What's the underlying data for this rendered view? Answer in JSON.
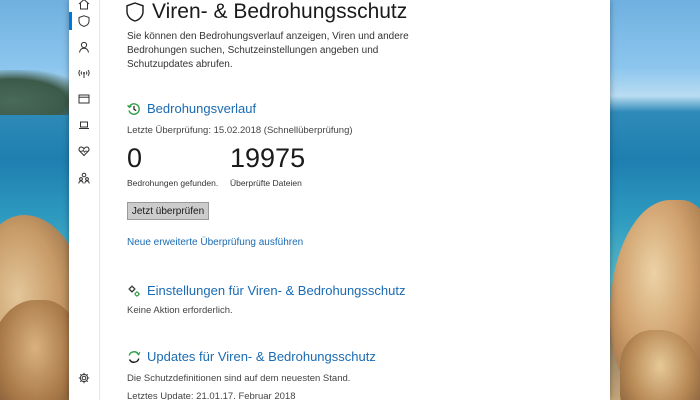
{
  "window": {
    "title": "Viren- & Bedrohungsschutz",
    "description": "Sie können den Bedrohungsverlauf anzeigen, Viren und andere Bedrohungen suchen, Schutzeinstellungen angeben und Schutzupdates abrufen."
  },
  "nav": {
    "items": [
      {
        "name": "home-icon",
        "active": false
      },
      {
        "name": "shield-icon",
        "active": true
      },
      {
        "name": "person-icon",
        "active": false
      },
      {
        "name": "wifi-icon",
        "active": false
      },
      {
        "name": "app-window-icon",
        "active": false
      },
      {
        "name": "laptop-icon",
        "active": false
      },
      {
        "name": "heart-icon",
        "active": false
      },
      {
        "name": "family-icon",
        "active": false
      },
      {
        "name": "settings-icon",
        "active": false
      }
    ]
  },
  "threat_history": {
    "heading": "Bedrohungsverlauf",
    "last_scan": "Letzte Überprüfung: 15.02.2018 (Schnellüberprüfung)",
    "threats_count": "0",
    "threats_label": "Bedrohungen gefunden.",
    "files_count": "19975",
    "files_label": "Überprüfte Dateien",
    "scan_button": "Jetzt überprüfen",
    "advanced_link": "Neue erweiterte Überprüfung ausführen"
  },
  "settings_section": {
    "heading": "Einstellungen für Viren- & Bedrohungsschutz",
    "status": "Keine Aktion erforderlich."
  },
  "updates_section": {
    "heading": "Updates für Viren- & Bedrohungsschutz",
    "status": "Die Schutzdefinitionen sind auf dem neuesten Stand.",
    "last_update": "Letztes Update: 21.01.17. Februar 2018"
  },
  "colors": {
    "accent": "#0078d7",
    "link": "#1a6bb3",
    "button_bg": "#cccccc"
  }
}
